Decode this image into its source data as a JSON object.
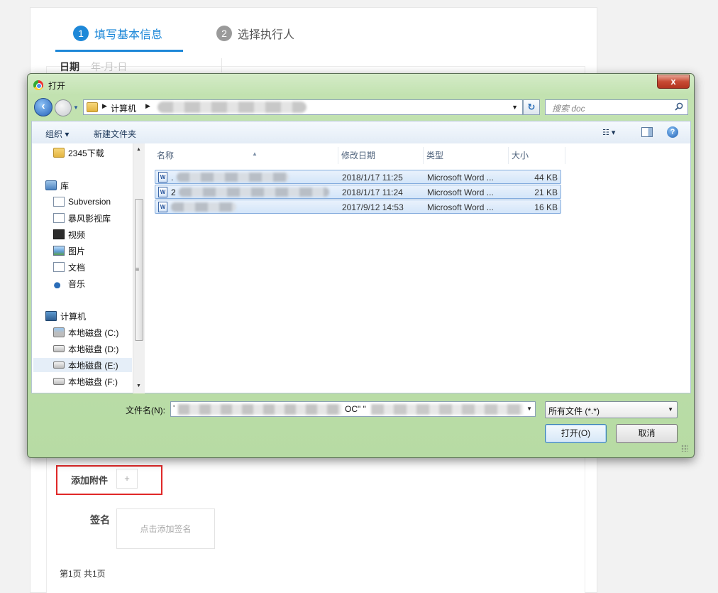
{
  "web_form": {
    "step1_num": "1",
    "step1_label": "填写基本信息",
    "step2_num": "2",
    "step2_label": "选择执行人",
    "date_label": "日期",
    "date_placeholder": "年-月-日",
    "attach_label": "添加附件",
    "attach_button": "+",
    "signature_label": "签名",
    "signature_placeholder": "点击添加签名",
    "pager": "第1页  共1页",
    "highlight_color": "#e02828",
    "accent_color": "#1e88d8"
  },
  "dialog": {
    "title": "打开",
    "close_label": "x",
    "address": {
      "breadcrumb_computer": "计算机",
      "breadcrumb_next": "z"
    },
    "search_placeholder": "搜索 doc",
    "toolbar": {
      "organize": "组织 ▾",
      "new_folder": "新建文件夹"
    },
    "nav": {
      "items": [
        {
          "label": "2345下载",
          "icon": "folder-icon"
        },
        {
          "label": "库",
          "icon": "library-icon"
        },
        {
          "label": "Subversion",
          "icon": "document-icon"
        },
        {
          "label": "暴风影视库",
          "icon": "document-icon"
        },
        {
          "label": "视频",
          "icon": "video-icon"
        },
        {
          "label": "图片",
          "icon": "picture-icon"
        },
        {
          "label": "文档",
          "icon": "document-icon"
        },
        {
          "label": "音乐",
          "icon": "music-icon"
        },
        {
          "label": "计算机",
          "icon": "computer-icon"
        },
        {
          "label": "本地磁盘 (C:)",
          "icon": "drive-icon"
        },
        {
          "label": "本地磁盘 (D:)",
          "icon": "drive-icon"
        },
        {
          "label": "本地磁盘 (E:)",
          "icon": "drive-icon"
        },
        {
          "label": "本地磁盘 (F:)",
          "icon": "drive-icon"
        }
      ]
    },
    "columns": {
      "name": "名称",
      "date": "修改日期",
      "type": "类型",
      "size": "大小"
    },
    "files": [
      {
        "name": ".",
        "date": "2018/1/17 11:25",
        "type": "Microsoft Word ...",
        "size": "44 KB"
      },
      {
        "name": "2",
        "date": "2018/1/17 11:24",
        "type": "Microsoft Word ...",
        "size": "21 KB"
      },
      {
        "name": "",
        "date": "2017/9/12 14:53",
        "type": "Microsoft Word ...",
        "size": "16 KB"
      }
    ],
    "filename_label": "文件名(N):",
    "filename_visible": "'",
    "filename_middle": "OC\" \"",
    "filter_value": "所有文件 (*.*)",
    "open_button": "打开(O)",
    "cancel_button": "取消"
  }
}
